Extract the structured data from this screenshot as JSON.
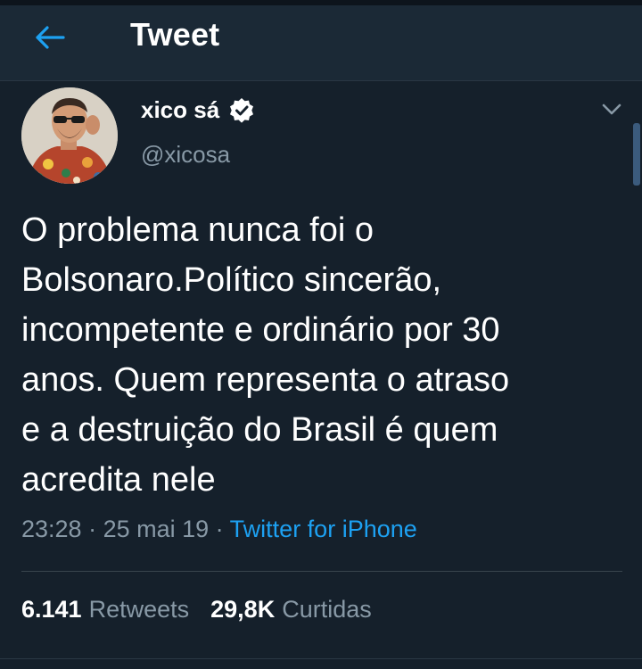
{
  "header": {
    "title": "Tweet",
    "back_icon": "arrow-left-icon"
  },
  "tweet": {
    "author": {
      "display_name": "xico sá",
      "handle": "@xicosa",
      "verified": true,
      "verified_icon": "verified-badge-icon"
    },
    "menu_icon": "chevron-down-icon",
    "text": "O problema nunca foi o\nBolsonaro.Político sincerão,\nincompetente e ordinário por 30\nanos. Quem representa o atraso\ne a destruição do Brasil é quem\nacredita nele",
    "time": "23:28",
    "separator": " · ",
    "date": "25 mai 19",
    "source": "Twitter for iPhone",
    "stats": {
      "retweets_count": "6.141",
      "retweets_label": "Retweets",
      "likes_count": "29,8K",
      "likes_label": "Curtidas"
    }
  },
  "colors": {
    "background": "#15202b",
    "header": "#1b2936",
    "accent": "#1da1f2",
    "secondary_text": "#8899a6"
  }
}
